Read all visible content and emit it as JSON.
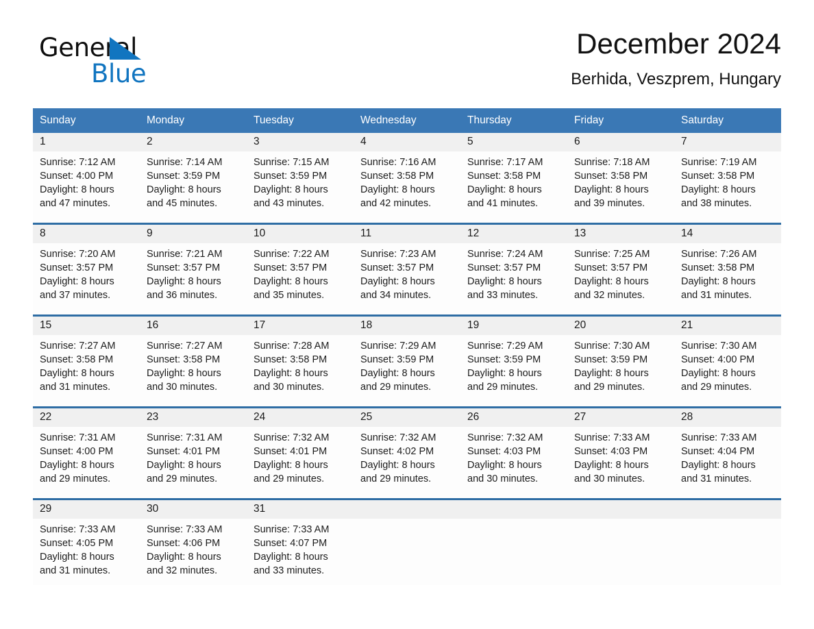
{
  "brand": {
    "name_part1": "General",
    "name_part2": "Blue",
    "flag_icon": "triangle-flag-icon",
    "accent_color": "#1175c0"
  },
  "header": {
    "title": "December 2024",
    "location": "Berhida, Veszprem, Hungary"
  },
  "calendar": {
    "header_bg": "#3a78b5",
    "row_divider_color": "#2e6da4",
    "day_band_bg": "#f0f0f0",
    "weekdays": [
      "Sunday",
      "Monday",
      "Tuesday",
      "Wednesday",
      "Thursday",
      "Friday",
      "Saturday"
    ],
    "weeks": [
      [
        {
          "day": "1",
          "lines": [
            "Sunrise: 7:12 AM",
            "Sunset: 4:00 PM",
            "Daylight: 8 hours",
            "and 47 minutes."
          ]
        },
        {
          "day": "2",
          "lines": [
            "Sunrise: 7:14 AM",
            "Sunset: 3:59 PM",
            "Daylight: 8 hours",
            "and 45 minutes."
          ]
        },
        {
          "day": "3",
          "lines": [
            "Sunrise: 7:15 AM",
            "Sunset: 3:59 PM",
            "Daylight: 8 hours",
            "and 43 minutes."
          ]
        },
        {
          "day": "4",
          "lines": [
            "Sunrise: 7:16 AM",
            "Sunset: 3:58 PM",
            "Daylight: 8 hours",
            "and 42 minutes."
          ]
        },
        {
          "day": "5",
          "lines": [
            "Sunrise: 7:17 AM",
            "Sunset: 3:58 PM",
            "Daylight: 8 hours",
            "and 41 minutes."
          ]
        },
        {
          "day": "6",
          "lines": [
            "Sunrise: 7:18 AM",
            "Sunset: 3:58 PM",
            "Daylight: 8 hours",
            "and 39 minutes."
          ]
        },
        {
          "day": "7",
          "lines": [
            "Sunrise: 7:19 AM",
            "Sunset: 3:58 PM",
            "Daylight: 8 hours",
            "and 38 minutes."
          ]
        }
      ],
      [
        {
          "day": "8",
          "lines": [
            "Sunrise: 7:20 AM",
            "Sunset: 3:57 PM",
            "Daylight: 8 hours",
            "and 37 minutes."
          ]
        },
        {
          "day": "9",
          "lines": [
            "Sunrise: 7:21 AM",
            "Sunset: 3:57 PM",
            "Daylight: 8 hours",
            "and 36 minutes."
          ]
        },
        {
          "day": "10",
          "lines": [
            "Sunrise: 7:22 AM",
            "Sunset: 3:57 PM",
            "Daylight: 8 hours",
            "and 35 minutes."
          ]
        },
        {
          "day": "11",
          "lines": [
            "Sunrise: 7:23 AM",
            "Sunset: 3:57 PM",
            "Daylight: 8 hours",
            "and 34 minutes."
          ]
        },
        {
          "day": "12",
          "lines": [
            "Sunrise: 7:24 AM",
            "Sunset: 3:57 PM",
            "Daylight: 8 hours",
            "and 33 minutes."
          ]
        },
        {
          "day": "13",
          "lines": [
            "Sunrise: 7:25 AM",
            "Sunset: 3:57 PM",
            "Daylight: 8 hours",
            "and 32 minutes."
          ]
        },
        {
          "day": "14",
          "lines": [
            "Sunrise: 7:26 AM",
            "Sunset: 3:58 PM",
            "Daylight: 8 hours",
            "and 31 minutes."
          ]
        }
      ],
      [
        {
          "day": "15",
          "lines": [
            "Sunrise: 7:27 AM",
            "Sunset: 3:58 PM",
            "Daylight: 8 hours",
            "and 31 minutes."
          ]
        },
        {
          "day": "16",
          "lines": [
            "Sunrise: 7:27 AM",
            "Sunset: 3:58 PM",
            "Daylight: 8 hours",
            "and 30 minutes."
          ]
        },
        {
          "day": "17",
          "lines": [
            "Sunrise: 7:28 AM",
            "Sunset: 3:58 PM",
            "Daylight: 8 hours",
            "and 30 minutes."
          ]
        },
        {
          "day": "18",
          "lines": [
            "Sunrise: 7:29 AM",
            "Sunset: 3:59 PM",
            "Daylight: 8 hours",
            "and 29 minutes."
          ]
        },
        {
          "day": "19",
          "lines": [
            "Sunrise: 7:29 AM",
            "Sunset: 3:59 PM",
            "Daylight: 8 hours",
            "and 29 minutes."
          ]
        },
        {
          "day": "20",
          "lines": [
            "Sunrise: 7:30 AM",
            "Sunset: 3:59 PM",
            "Daylight: 8 hours",
            "and 29 minutes."
          ]
        },
        {
          "day": "21",
          "lines": [
            "Sunrise: 7:30 AM",
            "Sunset: 4:00 PM",
            "Daylight: 8 hours",
            "and 29 minutes."
          ]
        }
      ],
      [
        {
          "day": "22",
          "lines": [
            "Sunrise: 7:31 AM",
            "Sunset: 4:00 PM",
            "Daylight: 8 hours",
            "and 29 minutes."
          ]
        },
        {
          "day": "23",
          "lines": [
            "Sunrise: 7:31 AM",
            "Sunset: 4:01 PM",
            "Daylight: 8 hours",
            "and 29 minutes."
          ]
        },
        {
          "day": "24",
          "lines": [
            "Sunrise: 7:32 AM",
            "Sunset: 4:01 PM",
            "Daylight: 8 hours",
            "and 29 minutes."
          ]
        },
        {
          "day": "25",
          "lines": [
            "Sunrise: 7:32 AM",
            "Sunset: 4:02 PM",
            "Daylight: 8 hours",
            "and 29 minutes."
          ]
        },
        {
          "day": "26",
          "lines": [
            "Sunrise: 7:32 AM",
            "Sunset: 4:03 PM",
            "Daylight: 8 hours",
            "and 30 minutes."
          ]
        },
        {
          "day": "27",
          "lines": [
            "Sunrise: 7:33 AM",
            "Sunset: 4:03 PM",
            "Daylight: 8 hours",
            "and 30 minutes."
          ]
        },
        {
          "day": "28",
          "lines": [
            "Sunrise: 7:33 AM",
            "Sunset: 4:04 PM",
            "Daylight: 8 hours",
            "and 31 minutes."
          ]
        }
      ],
      [
        {
          "day": "29",
          "lines": [
            "Sunrise: 7:33 AM",
            "Sunset: 4:05 PM",
            "Daylight: 8 hours",
            "and 31 minutes."
          ]
        },
        {
          "day": "30",
          "lines": [
            "Sunrise: 7:33 AM",
            "Sunset: 4:06 PM",
            "Daylight: 8 hours",
            "and 32 minutes."
          ]
        },
        {
          "day": "31",
          "lines": [
            "Sunrise: 7:33 AM",
            "Sunset: 4:07 PM",
            "Daylight: 8 hours",
            "and 33 minutes."
          ]
        },
        {
          "day": "",
          "lines": []
        },
        {
          "day": "",
          "lines": []
        },
        {
          "day": "",
          "lines": []
        },
        {
          "day": "",
          "lines": []
        }
      ]
    ]
  }
}
